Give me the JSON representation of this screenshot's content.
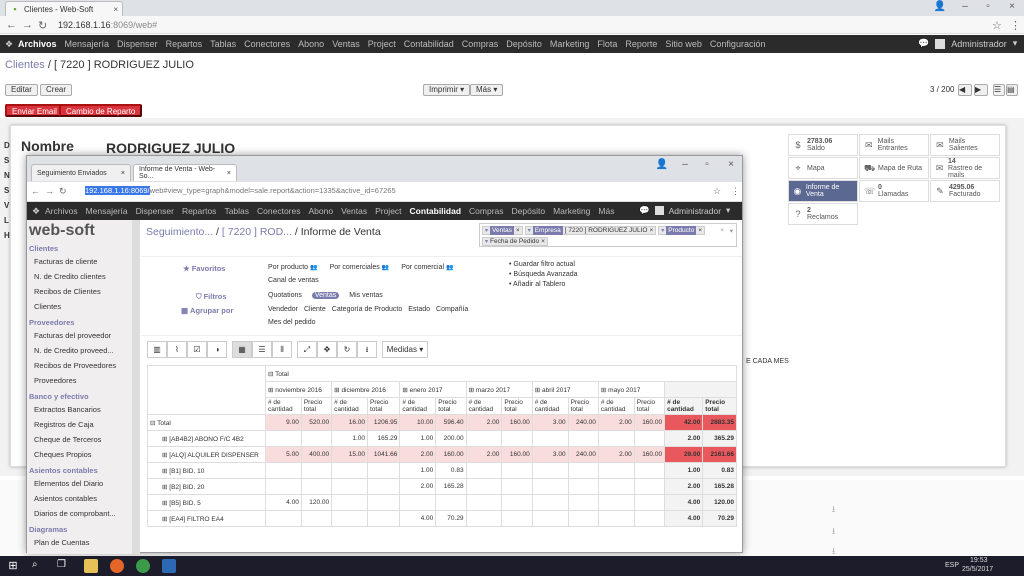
{
  "browser": {
    "tab_title": "Clientes - Web-Soft",
    "url_host": "192.168.1.16",
    "url_rest": ":8069/web#"
  },
  "menu": [
    "Archivos",
    "Mensajería",
    "Dispenser",
    "Repartos",
    "Tablas",
    "Conectores",
    "Abono",
    "Ventas",
    "Project",
    "Contabilidad",
    "Compras",
    "Depósito",
    "Marketing",
    "Flota",
    "Reporte",
    "Sitio web",
    "Configuración"
  ],
  "user": "Administrador",
  "breadcrumb": {
    "parent": "Clientes",
    "sep": "/",
    "current": "[ 7220 ] RODRIGUEZ JULIO"
  },
  "buttons": {
    "edit": "Editar",
    "create": "Crear",
    "print": "Imprimir",
    "more": "Más",
    "send_email": "Enviar Email",
    "change_route": "Cambio de Reparto"
  },
  "pager": "3 / 200",
  "form": {
    "name_label": "Nombre",
    "name_value": "RODRIGUEZ JULIO",
    "side_letters": [
      "D",
      "S",
      "N",
      "S",
      "V",
      "L",
      "H"
    ],
    "partial_text": "E CADA MES"
  },
  "smart_buttons": [
    {
      "icon": "balance-icon",
      "value": "2783.06",
      "label": "Saldo"
    },
    {
      "icon": "mail-in-icon",
      "value": "",
      "label": "Mails Entrantes"
    },
    {
      "icon": "mail-out-icon",
      "value": "",
      "label": "Mails Salientes"
    },
    {
      "icon": "map-pin-icon",
      "value": "",
      "label": "Mapa"
    },
    {
      "icon": "truck-icon",
      "value": "",
      "label": "Mapa de Ruta"
    },
    {
      "icon": "envelope-icon",
      "value": "14",
      "label": "Rastreo de mails"
    },
    {
      "icon": "eye-icon",
      "value": "",
      "label": "Informe de Venta"
    },
    {
      "icon": "phone-icon",
      "value": "0",
      "label": "Llamadas"
    },
    {
      "icon": "edit-icon",
      "value": "4295.06",
      "label": "Facturado"
    },
    {
      "icon": "help-icon",
      "value": "2",
      "label": "Reclamos"
    }
  ],
  "popup": {
    "tab1": "Seguimiento Enviados",
    "tab2": "Informe de Venta - Web-So...",
    "url_sel": "192.168.1.16:8069/",
    "url_rest": "web#view_type=graph&model=sale.report&action=1335&active_id=67265",
    "menu": [
      "Archivos",
      "Mensajería",
      "Dispenser",
      "Repartos",
      "Tablas",
      "Conectores",
      "Abono",
      "Ventas",
      "Project",
      "Contabilidad",
      "Compras",
      "Depósito",
      "Marketing",
      "Más"
    ],
    "user": "Administrador",
    "logo": "web-soft",
    "sidebar": [
      {
        "type": "h",
        "text": "Clientes"
      },
      {
        "type": "i",
        "text": "Facturas de cliente"
      },
      {
        "type": "i",
        "text": "N. de Credito clientes"
      },
      {
        "type": "i",
        "text": "Recibos de Clientes"
      },
      {
        "type": "i",
        "text": "Clientes"
      },
      {
        "type": "h",
        "text": "Proveedores"
      },
      {
        "type": "i",
        "text": "Facturas del proveedor"
      },
      {
        "type": "i",
        "text": "N. de Credito proveed..."
      },
      {
        "type": "i",
        "text": "Recibos de Proveedores"
      },
      {
        "type": "i",
        "text": "Proveedores"
      },
      {
        "type": "h",
        "text": "Banco y efectivo"
      },
      {
        "type": "i",
        "text": "Extractos Bancarios"
      },
      {
        "type": "i",
        "text": "Registros de Caja"
      },
      {
        "type": "i",
        "text": "Cheque de Terceros"
      },
      {
        "type": "i",
        "text": "Cheques Propios"
      },
      {
        "type": "h",
        "text": "Asientos contables"
      },
      {
        "type": "i",
        "text": "Elementos del Diario"
      },
      {
        "type": "i",
        "text": "Asientos contables"
      },
      {
        "type": "i",
        "text": "Diarios de comprobant..."
      },
      {
        "type": "h",
        "text": "Diagramas"
      },
      {
        "type": "i",
        "text": "Plan de Cuentas"
      }
    ],
    "title": {
      "p1": "Seguimiento...",
      "p2": "[ 7220 ] ROD...",
      "current": "Informe de Venta"
    },
    "facets": [
      {
        "k": "Ventas",
        "v": ""
      },
      {
        "k": "Empresa",
        "v": "[ 7220 ] RODRIGUEZ JULIO"
      },
      {
        "k": "Producto",
        "v": ""
      },
      {
        "k": "",
        "v": "Fecha de Pedido"
      }
    ],
    "favoritos": {
      "label": "Favoritos",
      "items": [
        "Por producto",
        "Por comerciales",
        "Por comercial",
        "Canal de ventas"
      ]
    },
    "filtros": {
      "label": "Filtros",
      "items": [
        "Quotations",
        "Ventas",
        "Mis ventas"
      ]
    },
    "agrupar": {
      "label": "Agrupar por",
      "items": [
        "Vendedor",
        "Cliente",
        "Categoría de Producto",
        "Estado",
        "Compañía",
        "Mes del pedido"
      ]
    },
    "save_opts": [
      "Guardar filtro actual",
      "Búsqueda Avanzada",
      "Añadir al Tablero"
    ],
    "measures": "Medidas",
    "pivot": {
      "total": "Total",
      "months": [
        "noviembre 2016",
        "diciembre 2016",
        "enero 2017",
        "marzo 2017",
        "abril 2017",
        "mayo 2017"
      ],
      "qty": "# de cantidad",
      "price": "Precio total",
      "rows": [
        {
          "label": "Total",
          "cells": [
            "9.00",
            "520.00",
            "16.00",
            "1206.95",
            "10.00",
            "596.40",
            "2.00",
            "160.00",
            "3.00",
            "240.00",
            "2.00",
            "160.00"
          ],
          "tq": "42.00",
          "tp": "2883.35",
          "hl": true
        },
        {
          "label": "[AB4B2] ABONO F/C 4B2",
          "cells": [
            "",
            "",
            "1.00",
            "165.29",
            "1.00",
            "200.00",
            "",
            "",
            "",
            "",
            "",
            ""
          ],
          "tq": "2.00",
          "tp": "365.29",
          "hl": false
        },
        {
          "label": "[ALQ] ALQUILER DISPENSER",
          "cells": [
            "5.00",
            "400.00",
            "15.00",
            "1041.66",
            "2.00",
            "160.00",
            "2.00",
            "160.00",
            "3.00",
            "240.00",
            "2.00",
            "160.00"
          ],
          "tq": "29.00",
          "tp": "2161.66",
          "hl": true
        },
        {
          "label": "[B1] BID. 10",
          "cells": [
            "",
            "",
            "",
            "",
            "1.00",
            "0.83",
            "",
            "",
            "",
            "",
            "",
            ""
          ],
          "tq": "1.00",
          "tp": "0.83",
          "hl": false
        },
        {
          "label": "[B2] BID. 20",
          "cells": [
            "",
            "",
            "",
            "",
            "2.00",
            "165.28",
            "",
            "",
            "",
            "",
            "",
            ""
          ],
          "tq": "2.00",
          "tp": "165.28",
          "hl": false
        },
        {
          "label": "[B5] BID. 5",
          "cells": [
            "4.00",
            "120.00",
            "",
            "",
            "",
            "",
            "",
            "",
            "",
            "",
            "",
            ""
          ],
          "tq": "4.00",
          "tp": "120.00",
          "hl": false
        },
        {
          "label": "[EA4] FILTRO EA4",
          "cells": [
            "",
            "",
            "",
            "",
            "4.00",
            "70.29",
            "",
            "",
            "",
            "",
            "",
            ""
          ],
          "tq": "4.00",
          "tp": "70.29",
          "hl": false
        }
      ]
    }
  },
  "taskbar": {
    "lang": "ESP",
    "time": "19:53",
    "date": "25/5/2017"
  }
}
